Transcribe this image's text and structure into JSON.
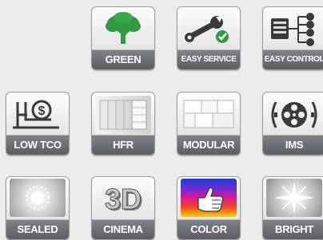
{
  "tiles": [
    {
      "label": "GREEN",
      "icon": "tree-icon"
    },
    {
      "label": "EASY SERVICE",
      "icon": "wrench-check-icon"
    },
    {
      "label": "EASY CONTROL",
      "icon": "network-control-icon"
    },
    {
      "label": "LOW TCO",
      "icon": "money-savings-icon"
    },
    {
      "label": "HFR",
      "icon": "film-frames-icon"
    },
    {
      "label": "MODULAR",
      "icon": "modules-grid-icon"
    },
    {
      "label": "IMS",
      "icon": "film-reel-icon"
    },
    {
      "label": "SEALED",
      "icon": "sealed-light-icon"
    },
    {
      "label": "CINEMA",
      "icon": "3d-icon"
    },
    {
      "label": "COLOR",
      "icon": "color-thumbs-up-icon"
    },
    {
      "label": "BRIGHT",
      "icon": "bright-star-icon"
    }
  ],
  "colors": {
    "green": "#2f9a3e",
    "label_bg": "#6b6f74"
  },
  "art_text": {
    "three_d": "3D"
  }
}
